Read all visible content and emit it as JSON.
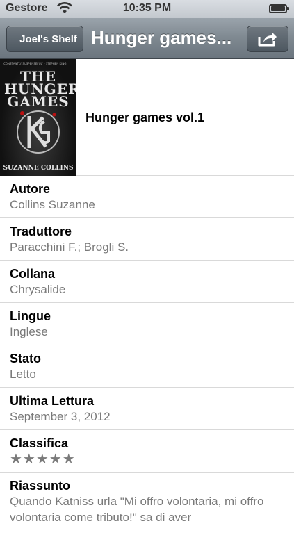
{
  "status_bar": {
    "carrier": "Gestore",
    "time": "10:35 PM",
    "battery_level": 1.0
  },
  "nav": {
    "back_label": "Joel's Shelf",
    "title": "Hunger games...",
    "share_icon": "share-icon"
  },
  "book": {
    "title": "Hunger games vol.1",
    "cover": {
      "top_text": "'CONSTANTLY SUSPENSEFUL' - STEPHEN KING",
      "title": "THE HUNGER GAMES",
      "author": "SUZANNE COLLINS"
    }
  },
  "details": [
    {
      "label": "Autore",
      "value": "Collins Suzanne"
    },
    {
      "label": "Traduttore",
      "value": "Paracchini F.; Brogli S."
    },
    {
      "label": "Collana",
      "value": "Chrysalide"
    },
    {
      "label": "Lingue",
      "value": "Inglese"
    },
    {
      "label": "Stato",
      "value": "Letto"
    },
    {
      "label": "Ultima Lettura",
      "value": "September 3, 2012"
    }
  ],
  "rating": {
    "label": "Classifica",
    "stars_display": "★★★★★",
    "stars": 5,
    "max": 5
  },
  "summary": {
    "label": "Riassunto",
    "text": "Quando Katniss urla \"Mi offro volontaria, mi offro volontaria come tributo!\" sa di aver"
  }
}
